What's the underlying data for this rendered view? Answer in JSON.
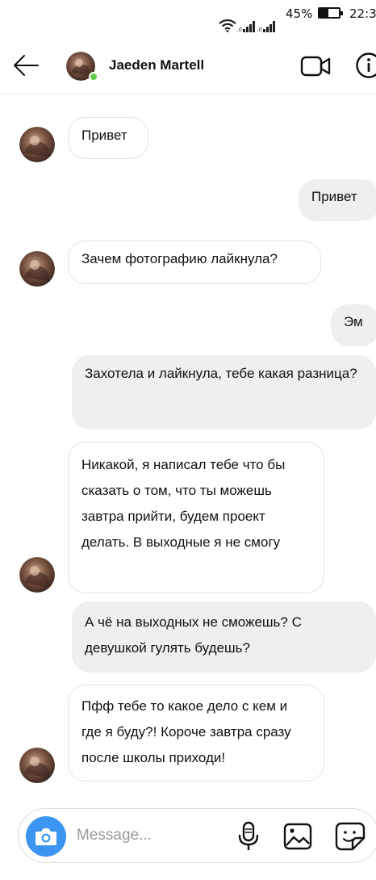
{
  "status_bar": {
    "battery_percent": "45%",
    "battery_level": 0.45,
    "time": "22:3",
    "icons": [
      "wifi-icon",
      "signal-icon",
      "signal-icon",
      "battery-icon"
    ]
  },
  "header": {
    "contact_name": "Jaeden Martell",
    "online": true,
    "icons": [
      "back-arrow-icon",
      "video-camera-icon",
      "info-icon"
    ]
  },
  "messages": [
    {
      "from": "them",
      "text": "Привет"
    },
    {
      "from": "me",
      "text": "Привет"
    },
    {
      "from": "them",
      "text": "Зачем фотографию лайкнула?"
    },
    {
      "from": "me",
      "text": "Эм"
    },
    {
      "from": "me",
      "text": "Захотела и лайкнула, тебе какая разница?"
    },
    {
      "from": "them",
      "text": "Никакой, я написал тебе что бы сказать о том, что ты можешь завтра прийти, будем проект делать. В выходные я не смогу"
    },
    {
      "from": "me",
      "text": "А чё на выходных не сможешь? С девушкой гулять будешь?"
    },
    {
      "from": "them",
      "text": "Пфф тебе то какое дело с кем и где я буду?! Короче завтра сразу после школы приходи!"
    }
  ],
  "composer": {
    "placeholder": "Message...",
    "value": "",
    "icons": [
      "camera-icon",
      "microphone-icon",
      "gallery-icon",
      "sticker-icon"
    ]
  },
  "colors": {
    "camera_button": "#3d95f2",
    "online_dot": "#5ec94b",
    "outgoing_bubble": "#efefef",
    "incoming_border": "#e3e3e3"
  }
}
